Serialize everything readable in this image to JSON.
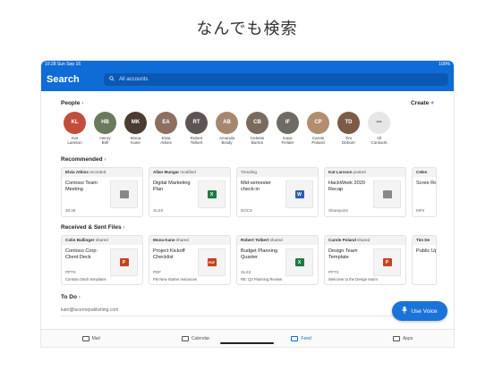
{
  "headline": "なんでも検索",
  "status": {
    "time": "10:28",
    "date": "Sun Sep 16",
    "battery": "100%"
  },
  "header": {
    "title": "Search",
    "search_placeholder": "All accounts"
  },
  "people": {
    "heading": "People",
    "create_label": "Create",
    "items": [
      {
        "first": "Kat",
        "last": "Larsson",
        "color": "#c24d3a",
        "init": "KL"
      },
      {
        "first": "Henry",
        "last": "Brill",
        "color": "#6b7a5a",
        "init": "HB"
      },
      {
        "first": "Mona",
        "last": "Kane",
        "color": "#4a3b33",
        "init": "MK"
      },
      {
        "first": "Elvia",
        "last": "Atkins",
        "color": "#8c6f5f",
        "init": "EA"
      },
      {
        "first": "Robert",
        "last": "Tolbert",
        "color": "#5d5551",
        "init": "RT"
      },
      {
        "first": "Amanda",
        "last": "Brady",
        "color": "#a58770",
        "init": "AB"
      },
      {
        "first": "Celeste",
        "last": "Burton",
        "color": "#7a6a5e",
        "init": "CB"
      },
      {
        "first": "Isaac",
        "last": "Fielder",
        "color": "#6f6a63",
        "init": "IF"
      },
      {
        "first": "Carole",
        "last": "Poland",
        "color": "#b28d6e",
        "init": "CP"
      },
      {
        "first": "Tim",
        "last": "Deboer",
        "color": "#7c5b46",
        "init": "TD"
      },
      {
        "first": "All",
        "last": "Contacts",
        "color": "#e6e6e6",
        "init": "•••"
      }
    ]
  },
  "recommended": {
    "heading": "Recommended",
    "cards": [
      {
        "who": "Elvia Atkins",
        "action": "recorded",
        "title": "Contoso Team Meeting",
        "type": "38:49",
        "icon": "video",
        "icon_color": "#888"
      },
      {
        "who": "Allan Mungar",
        "action": "modified",
        "title": "Digital Marketing Plan",
        "type": "XLSX",
        "icon": "X",
        "icon_color": "#1d7a43"
      },
      {
        "who": "",
        "action": "Trending",
        "title": "Mid-semester check-in",
        "type": "DOCX",
        "icon": "W",
        "icon_color": "#2b5fb4"
      },
      {
        "who": "Kat Larsson",
        "action": "posted",
        "title": "HackWeek 2020 Recap",
        "type": "Sharepoint",
        "icon": "doc",
        "icon_color": "#888"
      },
      {
        "who": "Celes",
        "action": "",
        "title": "Scree Recor",
        "type": "MP4",
        "icon": "",
        "icon_color": "#888"
      }
    ]
  },
  "files": {
    "heading": "Received & Sent Files",
    "cards": [
      {
        "who": "Colin Ballinger",
        "action": "shared",
        "title": "Contoso Corp: Client Deck",
        "type": "PPTX",
        "foot": "Contoso Deck templates",
        "icon": "P",
        "icon_color": "#c5431f"
      },
      {
        "who": "Mona Kane",
        "action": "shared",
        "title": "Project Kickoff Checklist",
        "type": "PDF",
        "foot": "FM New Starter resources",
        "icon": "PDF",
        "icon_color": "#c5431f"
      },
      {
        "who": "Robert Tolbert",
        "action": "shared",
        "title": "Budget Planning Quarter",
        "type": "XLXS",
        "foot": "RE: Q3 Planning Review",
        "icon": "X",
        "icon_color": "#1d7a43"
      },
      {
        "who": "Carole Poland",
        "action": "shared",
        "title": "Design Team Template",
        "type": "PPTX",
        "foot": "Welcome to the Design team!",
        "icon": "P",
        "icon_color": "#c5431f"
      },
      {
        "who": "Tim De",
        "action": "",
        "title": "Public Updat",
        "type": "",
        "foot": "",
        "icon": "",
        "icon_color": "#888"
      }
    ]
  },
  "todo": {
    "heading": "To Do",
    "input_text": "katri@lucernepublishing.com"
  },
  "voice_button": "Use Voice",
  "tabs": [
    {
      "label": "Mail",
      "active": false
    },
    {
      "label": "Calendar",
      "active": false
    },
    {
      "label": "Feed",
      "active": true
    },
    {
      "label": "Apps",
      "active": false
    }
  ]
}
